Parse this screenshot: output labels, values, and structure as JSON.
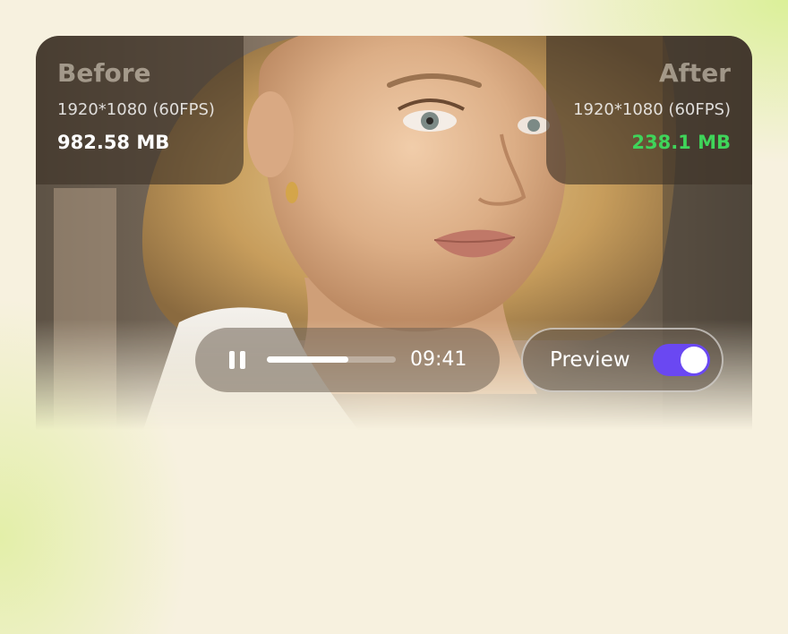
{
  "before": {
    "label": "Before",
    "resolution": "1920*1080 (60FPS)",
    "size": "982.58 MB"
  },
  "after": {
    "label": "After",
    "resolution": "1920*1080 (60FPS)",
    "size": "238.1 MB",
    "size_color": "#3fd45a"
  },
  "player": {
    "pause_icon": "pause-icon",
    "progress": 0.63,
    "time": "09:41"
  },
  "preview": {
    "label": "Preview",
    "enabled": true,
    "toggle_color": "#6a48f2"
  }
}
